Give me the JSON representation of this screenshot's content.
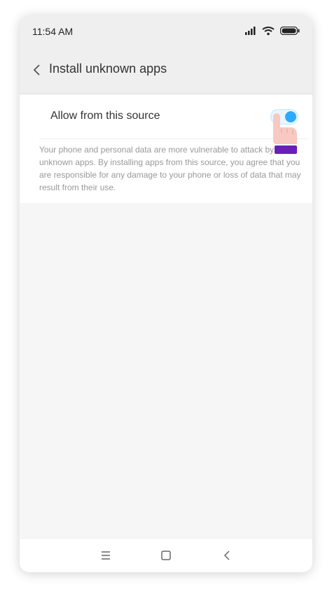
{
  "status_bar": {
    "time": "11:54 AM",
    "icons": [
      "signal-icon",
      "wifi-icon",
      "battery-icon"
    ]
  },
  "header": {
    "back_icon": "chevron-left-icon",
    "title": "Install unknown apps"
  },
  "setting": {
    "label": "Allow from this source",
    "toggle_on": true,
    "toggle_color": "#2fa8ff"
  },
  "description": "Your phone and personal data are more vulnerable to attack by unknown apps. By installing apps from this source, you agree that you are responsible for any damage to your phone or loss of data that may result from their use.",
  "nav_bar": {
    "buttons": [
      "menu-icon",
      "home-icon",
      "back-icon"
    ]
  },
  "overlay": {
    "hand_icon": "pointing-hand-icon"
  }
}
